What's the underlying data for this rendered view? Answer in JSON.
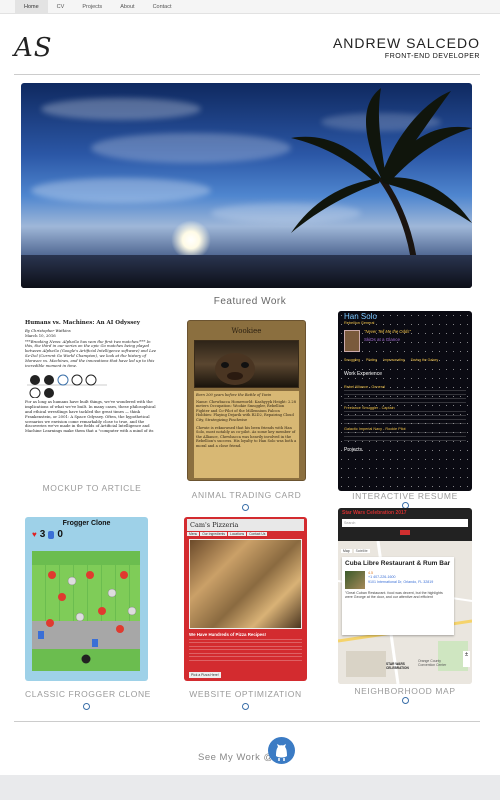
{
  "nav": {
    "items": [
      {
        "label": "Home",
        "active": true
      },
      {
        "label": "CV",
        "active": false
      },
      {
        "label": "Projects",
        "active": false
      },
      {
        "label": "About",
        "active": false
      },
      {
        "label": "Contact",
        "active": false
      }
    ]
  },
  "header": {
    "logo": "AS",
    "name": "ANDREW SALCEDO",
    "role": "FRONT-END DEVELOPER"
  },
  "hero": {
    "description_icon": "beach-sunset-image"
  },
  "featured": {
    "title": "Featured Work",
    "cards": [
      {
        "caption": "MOCKUP TO ARTICLE",
        "key": "article"
      },
      {
        "caption": "ANIMAL TRADING CARD",
        "key": "wookiee"
      },
      {
        "caption": "INTERACTIVE RESUME",
        "key": "hansolo"
      },
      {
        "caption": "CLASSIC FROGGER CLONE",
        "key": "frogger"
      },
      {
        "caption": "WEBSITE OPTIMIZATION",
        "key": "pizza"
      },
      {
        "caption": "NEIGHBORHOOD MAP",
        "key": "map"
      }
    ]
  },
  "article": {
    "headline": "Humans vs. Machines: An AI Odyssey",
    "byline": "By Christopher Watkins",
    "date": "March 10, 2016",
    "lead": "***Breaking News: AlphaGo has won the first two matches!*** In this, the third in our series on the epic Go matches being played between AlphaGo (Google's Artificial Intelligence software) and Lee Se-Dol (Current Go World Champion), we look at the history of Moravec vs. Machines, and the innovations that have led up to this incredible moment in time.",
    "body": "For as long as humans have built things, we've wondered with the implications of what we've built. In many cases, these philosophical and ethical wrestlings have tackled the great times — think Frankenstein, or 2001: A Space Odyssey. Often, the hypothetical scenarios we envision come remarkably close to true, and the discoveries we've made in the fields of Artificial Intelligence and Machine Learnings make them that a \"computer with a mind of its"
  },
  "wookiee": {
    "title": "Wookiee",
    "subtitle": "Born 200 years before the Battle of Yavin",
    "details": "Name: Chewbacca Homeworld: Kashyyyk Height: 2.28 meters Occupation: Wookie Smuggler, Rebellion Fighter and Co-Pilot of the Millennium Falcon Hobbies: Playing Dejarik with R2D2, Repairing Cloud City, Strategizing Pinchwise",
    "footer": "Chewie is reknowned that his been friends with Han Solo, most notably as co-pilot. As some key member of the Alliance, Chewbacca was heavily involved in the Rebellion's success. His loyalty to Han Solo was both a moral and a close friend."
  },
  "hansolo": {
    "name": "Han Solo",
    "role": "Rebellion General",
    "quote": "\"Never Tell Me the Odds\"",
    "tagline": "SkiDs at a Glance",
    "skills": [
      "Smuggling",
      "Piloting",
      "Impersonating",
      "Saving the Galaxy"
    ],
    "section1": "Work Experience",
    "job1": "Rebel Alliance - General",
    "job2": "Freelance Smuggler - Captain",
    "job3": "Galactic Imperial Navy - Rookie Pilot",
    "section2": "Projects"
  },
  "frogger": {
    "title": "Frogger Clone",
    "lives": "3",
    "score": "0"
  },
  "pizza": {
    "title": "Cam's Pizzeria",
    "nav": [
      "Menu",
      "Our Ingredients",
      "Locations",
      "Contact Us"
    ],
    "tagline": "We Have Hundreds of Pizza Recipes!",
    "button": "Pick a Pizza Here!"
  },
  "mapcard": {
    "header": "Star Wars Celebration 2017",
    "search_placeholder": "Search",
    "tab_map": "Map",
    "tab_satellite": "Satellite",
    "place": "Cuba Libre Restaurant & Rum Bar",
    "rating": "4.5",
    "phone": "+1 407-226-1600",
    "address": "9101 International Dr, Orlando, FL 32819",
    "review": "\"Great Cuban Restaurant. food was decent, but the highlights were George at the door, and our attentive and efficient",
    "landmark": "Orange County Convention Center",
    "brand": "STAR WARS CELEBRATION"
  },
  "footer": {
    "text": "See My Work @"
  }
}
